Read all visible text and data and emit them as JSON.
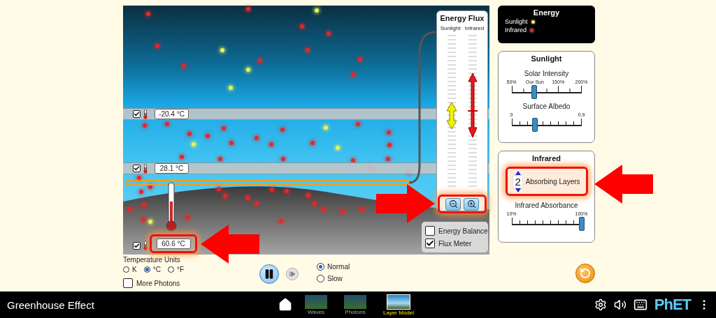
{
  "app": {
    "title": "Greenhouse Effect",
    "logo": "PhET"
  },
  "nav": {
    "screens": [
      {
        "label": "Waves",
        "selected": false
      },
      {
        "label": "Photons",
        "selected": false
      },
      {
        "label": "Layer Model",
        "selected": true
      }
    ]
  },
  "scene": {
    "layers": [
      {
        "reading": "-20.4 °C",
        "checked": true
      },
      {
        "reading": "28.1 °C",
        "checked": true
      }
    ],
    "surface": {
      "reading": "60.6 °C",
      "checked": true,
      "highlighted": true
    },
    "flux_meter": {
      "title": "Energy Flux",
      "columns": [
        "Sunlight",
        "Infrared"
      ],
      "zoom_highlighted": true
    },
    "options": [
      {
        "kind": "energy_balance",
        "label": "Energy Balance",
        "checked": false
      },
      {
        "kind": "flux_meter",
        "label": "Flux Meter",
        "checked": true
      }
    ]
  },
  "temperature_units": {
    "title": "Temperature Units",
    "options": [
      {
        "label": "K",
        "selected": false
      },
      {
        "label": "°C",
        "selected": true
      },
      {
        "label": "°F",
        "selected": false
      }
    ]
  },
  "more_photons": {
    "label": "More Photons",
    "checked": false
  },
  "playback": {
    "playing": true,
    "speeds": [
      {
        "label": "Normal",
        "selected": true
      },
      {
        "label": "Slow",
        "selected": false
      }
    ]
  },
  "legend": {
    "title": "Energy",
    "items": [
      {
        "label": "Sunlight",
        "color": "#f2f25a"
      },
      {
        "label": "Infrared",
        "color": "#e8262a"
      }
    ]
  },
  "sunlight": {
    "title": "Sunlight",
    "sliders": [
      {
        "label": "Solar Intensity",
        "ticks": [
          "50%",
          "Our Sun",
          "150%",
          "200%"
        ],
        "level": 0.32
      },
      {
        "label": "Surface Albedo",
        "ticks": [
          "0",
          "0.9"
        ],
        "level": 0.33
      }
    ]
  },
  "infrared": {
    "title": "Infrared",
    "layers": {
      "value": "2",
      "label": "Absorbing Layers",
      "highlighted": true
    },
    "slider": {
      "label": "Infrared Absorbance",
      "ticks": [
        "10%",
        "100%"
      ],
      "level": 1
    }
  }
}
